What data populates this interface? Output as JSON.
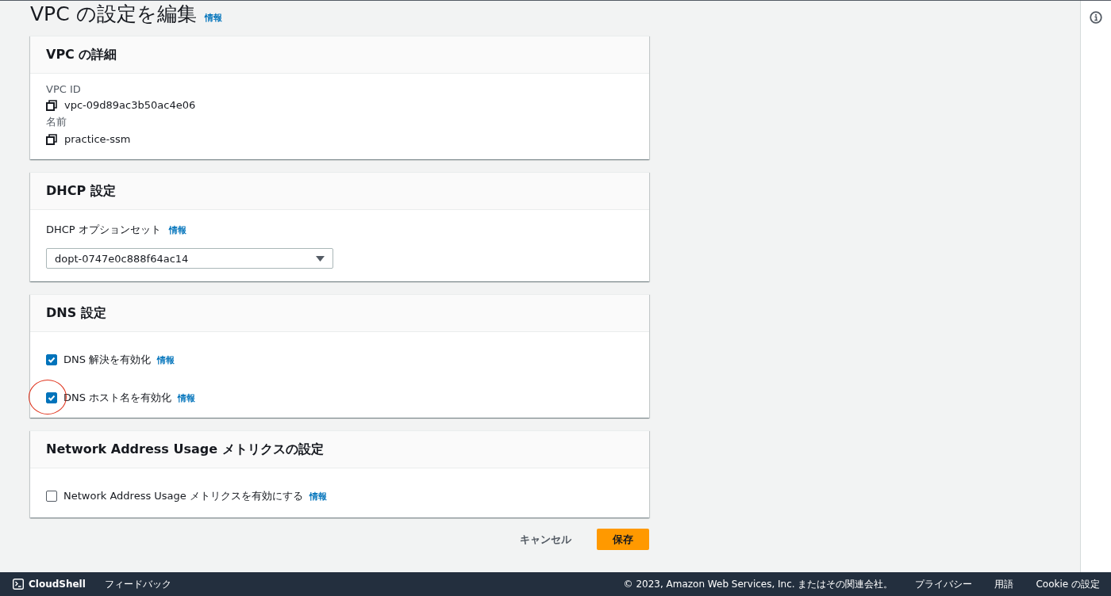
{
  "page": {
    "title": "VPC の設定を編集",
    "info": "情報"
  },
  "details": {
    "title": "VPC の詳細",
    "fields": [
      {
        "label": "VPC ID",
        "value": "vpc-09d89ac3b50ac4e06"
      },
      {
        "label": "名前",
        "value": "practice-ssm"
      }
    ]
  },
  "dhcp": {
    "title": "DHCP 設定",
    "label": "DHCP オプションセット",
    "info": "情報",
    "value": "dopt-0747e0c888f64ac14"
  },
  "dns": {
    "title": "DNS 設定",
    "options": [
      {
        "label": "DNS 解決を有効化",
        "info": "情報",
        "checked": true,
        "highlighted": false
      },
      {
        "label": "DNS ホスト名を有効化",
        "info": "情報",
        "checked": true,
        "highlighted": true
      }
    ]
  },
  "nau": {
    "title": "Network Address Usage メトリクスの設定",
    "options": [
      {
        "label": "Network Address Usage メトリクスを有効にする",
        "info": "情報",
        "checked": false,
        "highlighted": false
      }
    ]
  },
  "actions": {
    "cancel": "キャンセル",
    "save": "保存"
  },
  "footer": {
    "cloudshell": "CloudShell",
    "feedback": "フィードバック",
    "copyright": "© 2023, Amazon Web Services, Inc. またはその関連会社。",
    "links": [
      "プライバシー",
      "用語",
      "Cookie の設定"
    ]
  }
}
